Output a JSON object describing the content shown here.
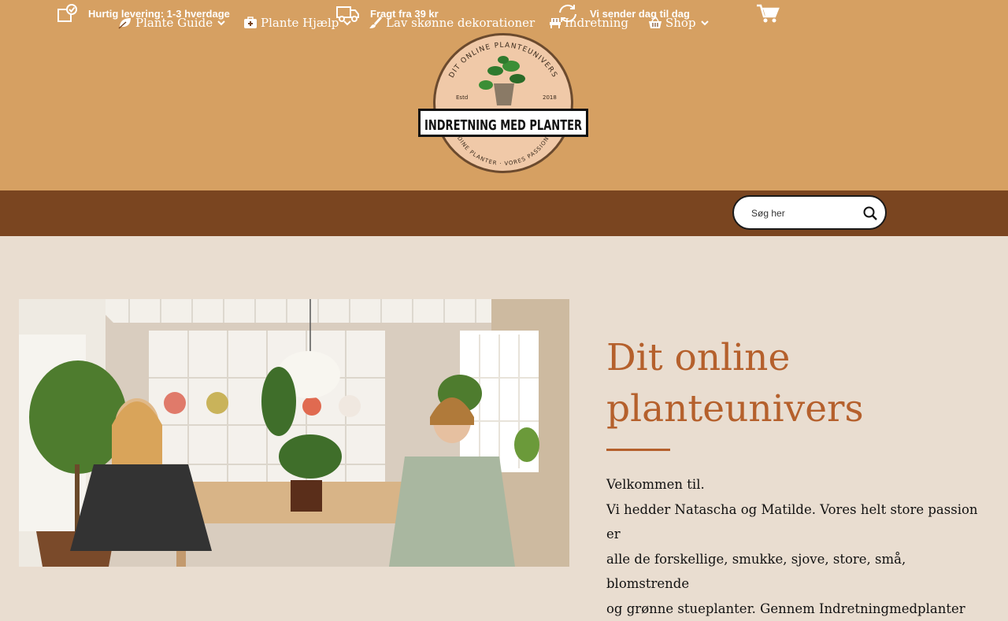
{
  "topbar": {
    "usps": [
      {
        "icon": "checkbox-box-icon",
        "text": "Hurtig levering: 1-3 hverdage"
      },
      {
        "icon": "delivery-truck-icon",
        "text": "Fragt fra 39 kr"
      },
      {
        "icon": "refresh-icon",
        "text": "Vi sender dag til dag"
      }
    ],
    "cart_icon": "cart-icon"
  },
  "logo": {
    "arc_top": "DIT ONLINE PLANTEUNIVERS",
    "estd": "Estd",
    "year": "2018",
    "banner": "INDRETNING MED PLANTER",
    "arc_bottom": "DINE PLANTER · VORES PASSION"
  },
  "nav": {
    "items": [
      {
        "label": "Plante Guide",
        "icon": "leaf-icon",
        "dropdown": true
      },
      {
        "label": "Plante Hjælp",
        "icon": "first-aid-kit-icon",
        "dropdown": true
      },
      {
        "label": "Lav skønne dekorationer",
        "icon": "paint-brush-icon",
        "dropdown": false
      },
      {
        "label": "Indretning",
        "icon": "armchair-icon",
        "dropdown": false
      },
      {
        "label": "Shop",
        "icon": "shopping-basket-icon",
        "dropdown": true
      }
    ],
    "search": {
      "placeholder": "Søg her",
      "icon": "search-icon"
    }
  },
  "hero": {
    "heading_line1": "Dit online",
    "heading_line2": "planteunivers",
    "paragraph_line1": "Velkommen til.",
    "paragraph_line2": "Vi hedder Natascha og Matilde. Vores helt store passion er",
    "paragraph_line3": "alle de forskellige, smukke, sjove, store, små, blomstrende",
    "paragraph_line4": "og grønne stueplanter. Gennem Indretningmedplanter"
  },
  "colors": {
    "header_bg": "#d6a062",
    "nav_bg": "#7a4520",
    "page_bg": "#e9ddd0",
    "accent": "#b5602c"
  }
}
